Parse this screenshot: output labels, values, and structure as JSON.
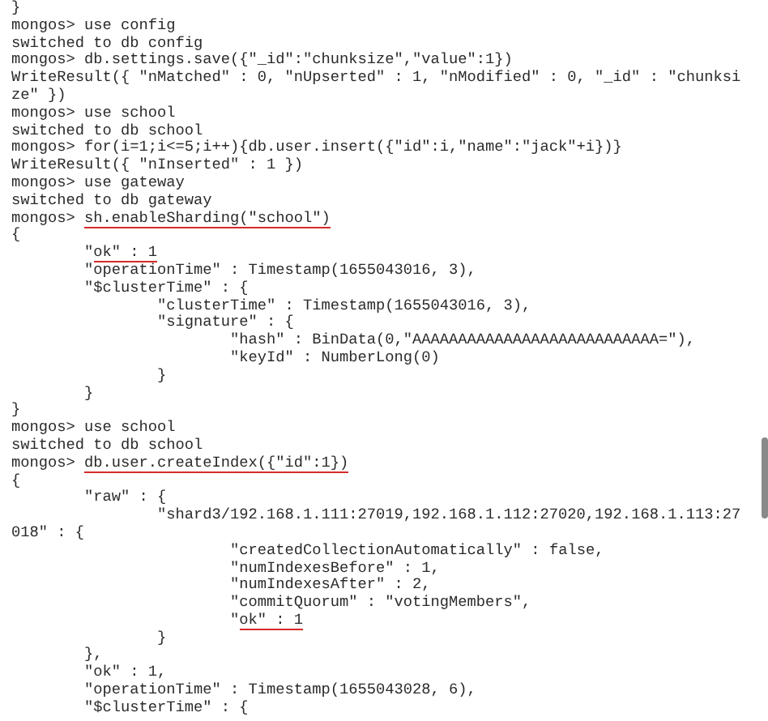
{
  "terminal": {
    "lines": [
      {
        "text": "}"
      },
      {
        "text": "mongos> use config"
      },
      {
        "text": "switched to db config"
      },
      {
        "text": "mongos> db.settings.save({\"_id\":\"chunksize\",\"value\":1})"
      },
      {
        "text": "WriteResult({ \"nMatched\" : 0, \"nUpserted\" : 1, \"nModified\" : 0, \"_id\" : \"chunksi"
      },
      {
        "text": "ze\" })"
      },
      {
        "text": "mongos> use school"
      },
      {
        "text": "switched to db school"
      },
      {
        "text": "mongos> for(i=1;i<=5;i++){db.user.insert({\"id\":i,\"name\":\"jack\"+i})}"
      },
      {
        "text": "WriteResult({ \"nInserted\" : 1 })"
      },
      {
        "text": "mongos> use gateway"
      },
      {
        "text": "switched to db gateway"
      },
      {
        "text": "mongos> ",
        "marked": "sh.enableSharding(\"school\")"
      },
      {
        "text": "{"
      },
      {
        "text": "\t\"",
        "marked": "ok\" : 1"
      },
      {
        "text": "\t\"operationTime\" : Timestamp(1655043016, 3),"
      },
      {
        "text": "\t\"$clusterTime\" : {"
      },
      {
        "text": "\t\t\"clusterTime\" : Timestamp(1655043016, 3),"
      },
      {
        "text": "\t\t\"signature\" : {"
      },
      {
        "text": "\t\t\t\"hash\" : BinData(0,\"AAAAAAAAAAAAAAAAAAAAAAAAAAA=\"),"
      },
      {
        "text": "\t\t\t\"keyId\" : NumberLong(0)"
      },
      {
        "text": "\t\t}"
      },
      {
        "text": "\t}"
      },
      {
        "text": "}"
      },
      {
        "text": "mongos> use school"
      },
      {
        "text": "switched to db school"
      },
      {
        "text": "mongos> ",
        "marked": "db.user.createIndex({\"id\":1})"
      },
      {
        "text": "{"
      },
      {
        "text": "\t\"raw\" : {"
      },
      {
        "text": "\t\t\"shard3/192.168.1.111:27019,192.168.1.112:27020,192.168.1.113:27"
      },
      {
        "text": "018\" : {"
      },
      {
        "text": "\t\t\t\"createdCollectionAutomatically\" : false,"
      },
      {
        "text": "\t\t\t\"numIndexesBefore\" : 1,"
      },
      {
        "text": "\t\t\t\"numIndexesAfter\" : 2,"
      },
      {
        "text": "\t\t\t\"commitQuorum\" : \"votingMembers\","
      },
      {
        "text": "\t\t\t\"",
        "marked": "ok\" : 1"
      },
      {
        "text": "\t\t}"
      },
      {
        "text": "\t},"
      },
      {
        "text": "\t\"ok\" : 1,"
      },
      {
        "text": "\t\"operationTime\" : Timestamp(1655043028, 6),"
      },
      {
        "text": "\t\"$clusterTime\" : {"
      }
    ]
  }
}
